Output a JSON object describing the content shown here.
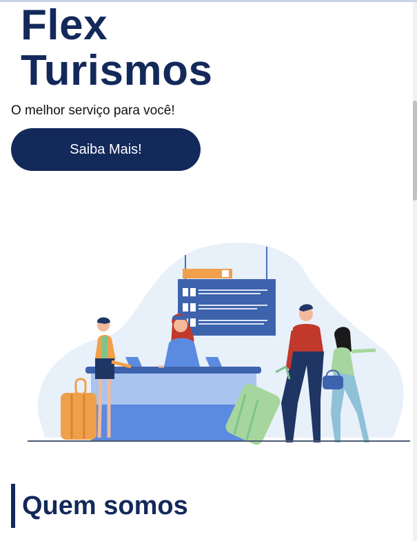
{
  "hero": {
    "title_line1": "Flex",
    "title_line2": "Turismos",
    "subtitle": "O melhor serviço para você!",
    "cta_label": "Saiba Mais!"
  },
  "illustration": {
    "description_icon": "airport-check-in-illustration"
  },
  "sections": {
    "about_title": "Quem somos"
  },
  "colors": {
    "brand": "#13295a",
    "accent_blue": "#5b8be0",
    "background": "#ffffff"
  }
}
